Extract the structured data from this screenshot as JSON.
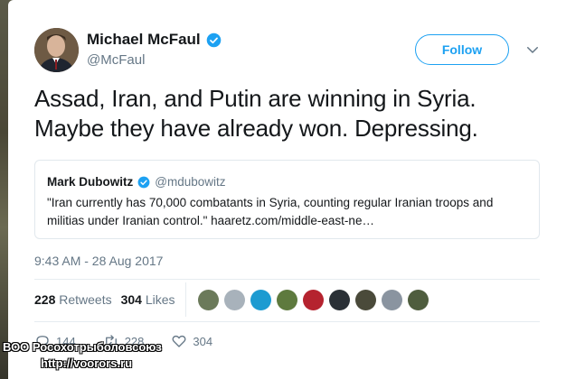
{
  "author": {
    "name": "Michael McFaul",
    "handle": "@McFaul",
    "verified": true
  },
  "follow_button": {
    "label": "Follow"
  },
  "tweet": {
    "line1": "Assad, Iran, and Putin are winning in Syria.",
    "line2": "Maybe they have already won. Depressing."
  },
  "quoted_tweet": {
    "name": "Mark Dubowitz",
    "handle": "@mdubowitz",
    "verified": true,
    "text_line1": "\"Iran currently has 70,000 combatants in Syria, counting regular Iranian troops and",
    "text_line2": "militias under Iranian control.\" haaretz.com/middle-east-ne…"
  },
  "timestamp": "9:43 AM - 28 Aug 2017",
  "stats": {
    "retweets_count": "228",
    "retweets_label": "Retweets",
    "likes_count": "304",
    "likes_label": "Likes"
  },
  "likers": [
    {
      "color": "#6b7a5a"
    },
    {
      "color": "#a8b2bb"
    },
    {
      "color": "#1d9bd1"
    },
    {
      "color": "#5e7a3e"
    },
    {
      "color": "#b5232f"
    },
    {
      "color": "#2a3036"
    },
    {
      "color": "#4a4a3a"
    },
    {
      "color": "#8a94a0"
    },
    {
      "color": "#4f5d3e"
    }
  ],
  "actions": {
    "reply_count": "144",
    "retweet_count": "228",
    "like_count": "304"
  },
  "colors": {
    "brand": "#1da1f2",
    "text": "#14171a",
    "muted": "#657786"
  },
  "watermark": {
    "line1": "ВОО Росохотрыболовсоюз",
    "line2": "http://voorors.ru"
  }
}
